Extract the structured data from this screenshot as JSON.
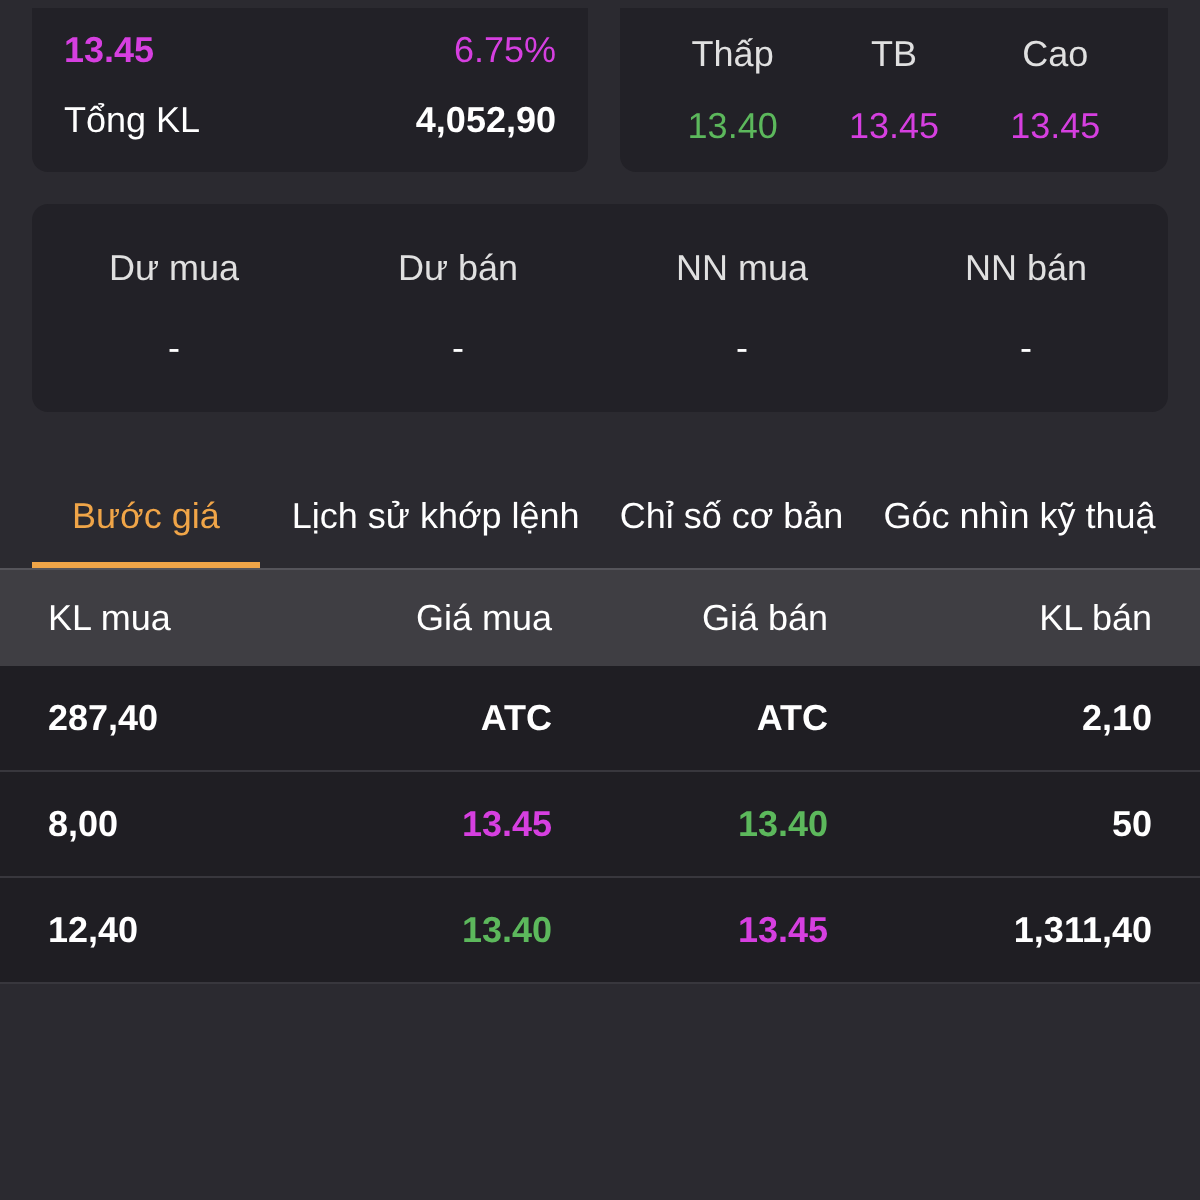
{
  "summary": {
    "price": "13.45",
    "change_pct": "6.75%",
    "volume_label": "Tổng KL",
    "volume": "4,052,90"
  },
  "range": [
    {
      "label": "Thấp",
      "value": "13.40",
      "color": "#5cb85c"
    },
    {
      "label": "TB",
      "value": "13.45",
      "color": "#d63fe0"
    },
    {
      "label": "Cao",
      "value": "13.45",
      "color": "#d63fe0"
    }
  ],
  "flows": [
    {
      "label": "Dư mua",
      "value": "-"
    },
    {
      "label": "Dư bán",
      "value": "-"
    },
    {
      "label": "NN mua",
      "value": "-"
    },
    {
      "label": "NN bán",
      "value": "-"
    }
  ],
  "tabs": [
    {
      "label": "Bước giá",
      "selected": true
    },
    {
      "label": "Lịch sử khớp lệnh",
      "selected": false
    },
    {
      "label": "Chỉ số cơ bản",
      "selected": false
    },
    {
      "label": "Góc nhìn kỹ thuậ",
      "selected": false
    }
  ],
  "table": {
    "columns": [
      "KL mua",
      "Giá mua",
      "Giá bán",
      "KL bán"
    ],
    "rows": [
      {
        "cells": [
          {
            "text": "287,40"
          },
          {
            "text": "ATC",
            "color": "#ffffff"
          },
          {
            "text": "ATC",
            "color": "#ffffff"
          },
          {
            "text": "2,10"
          }
        ]
      },
      {
        "cells": [
          {
            "text": "8,00"
          },
          {
            "text": "13.45",
            "color": "#d63fe0"
          },
          {
            "text": "13.40",
            "color": "#5cb85c"
          },
          {
            "text": "50"
          }
        ]
      },
      {
        "cells": [
          {
            "text": "12,40"
          },
          {
            "text": "13.40",
            "color": "#5cb85c"
          },
          {
            "text": "13.45",
            "color": "#d63fe0"
          },
          {
            "text": "1,311,40"
          }
        ]
      }
    ]
  }
}
